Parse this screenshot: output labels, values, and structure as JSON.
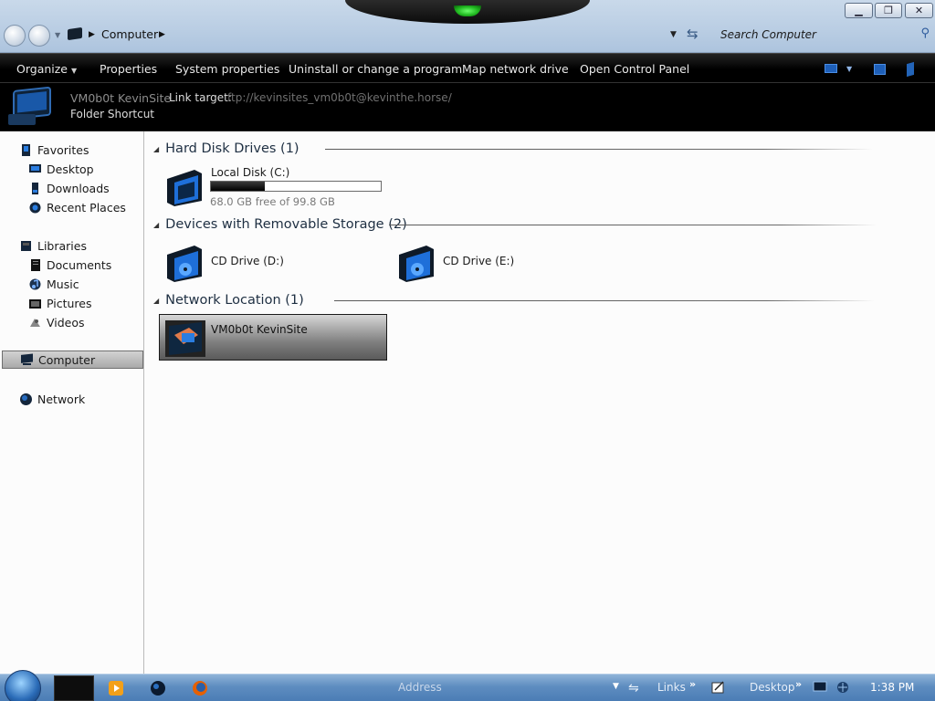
{
  "address_bar": {
    "breadcrumb": [
      "Computer"
    ],
    "search_placeholder": "Search Computer"
  },
  "command_bar": {
    "items": [
      "Organize",
      "Properties",
      "System properties",
      "Uninstall or change a program",
      "Map network drive",
      "Open Control Panel"
    ]
  },
  "details": {
    "name": "VM0b0t KevinSite",
    "link_label": "Link target:",
    "link_value": "ftp://kevinsites_vm0b0t@kevinthe.horse/",
    "type": "Folder Shortcut"
  },
  "nav": {
    "favorites": {
      "label": "Favorites",
      "items": [
        "Desktop",
        "Downloads",
        "Recent Places"
      ]
    },
    "libraries": {
      "label": "Libraries",
      "items": [
        "Documents",
        "Music",
        "Pictures",
        "Videos"
      ]
    },
    "computer": "Computer",
    "network": "Network"
  },
  "content": {
    "groups": [
      {
        "title": "Hard Disk Drives (1)"
      },
      {
        "title": "Devices with Removable Storage (2)"
      },
      {
        "title": "Network Location (1)"
      }
    ],
    "local_disk": {
      "name": "Local Disk (C:)",
      "free_text": "68.0 GB free of 99.8 GB",
      "used_fraction": 0.319
    },
    "cd_d": {
      "name": "CD Drive (D:)"
    },
    "cd_e": {
      "name": "CD Drive (E:)"
    },
    "network_location": {
      "name": "VM0b0t KevinSite"
    }
  },
  "taskbar": {
    "address_label": "Address",
    "links_label": "Links",
    "desktop_label": "Desktop",
    "clock": "1:38 PM"
  },
  "colors": {
    "accent": "#1e6fd9",
    "taskbar": "#5e8dc0",
    "command_bar": "#000000"
  }
}
